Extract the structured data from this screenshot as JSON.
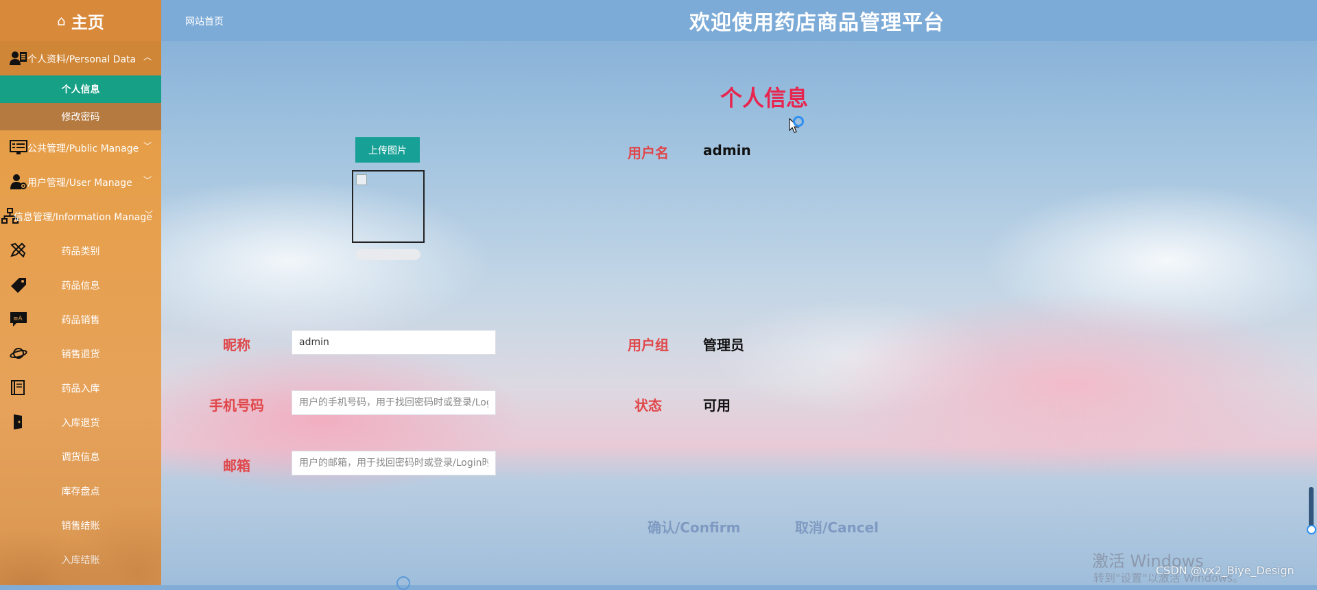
{
  "sidebar": {
    "brand": "主页",
    "groups": [
      {
        "label": "个人资料/Personal Data",
        "expanded": true,
        "icon": "user-card-icon"
      },
      {
        "label": "公共管理/Public Manage",
        "expanded": false,
        "icon": "monitor-list-icon"
      },
      {
        "label": "用户管理/User Manage",
        "expanded": false,
        "icon": "user-gear-icon"
      },
      {
        "label": "信息管理/Information Manage",
        "expanded": false,
        "icon": "sitemap-icon"
      }
    ],
    "personal_items": [
      {
        "label": "个人信息",
        "active": true
      },
      {
        "label": "修改密码",
        "active": false
      }
    ],
    "info_items": [
      {
        "label": "药品类别",
        "icon": "pencil-ruler-icon"
      },
      {
        "label": "药品信息",
        "icon": "tag-icon"
      },
      {
        "label": "药品销售",
        "icon": "chat-translate-icon"
      },
      {
        "label": "销售退货",
        "icon": "planet-icon"
      },
      {
        "label": "药品入库",
        "icon": "book-icon"
      },
      {
        "label": "入库退货",
        "icon": "door-icon"
      },
      {
        "label": "调货信息",
        "icon": ""
      },
      {
        "label": "库存盘点",
        "icon": ""
      },
      {
        "label": "销售结账",
        "icon": ""
      },
      {
        "label": "入库结账",
        "icon": ""
      }
    ]
  },
  "topbar": {
    "breadcrumb": "网站首页",
    "title": "欢迎使用药店商品管理平台"
  },
  "main": {
    "page_title": "个人信息",
    "upload_label": "上传图片",
    "fields": {
      "username_label": "用户名",
      "username_value": "admin",
      "nickname_label": "昵称",
      "nickname_value": "admin",
      "usergroup_label": "用户组",
      "usergroup_value": "管理员",
      "phone_label": "手机号码",
      "phone_placeholder": "用户的手机号码，用于找回密码时或登录/Login时",
      "status_label": "状态",
      "status_value": "可用",
      "email_label": "邮箱",
      "email_placeholder": "用户的邮箱，用于找回密码时或登录/Login时"
    },
    "confirm_label": "确认/Confirm",
    "cancel_label": "取消/Cancel"
  },
  "overlay": {
    "watermark": "激活 Windows",
    "watermark_sub": "转到\"设置\"以激活 Windows。",
    "csdn": "CSDN @vx2_Biye_Design"
  },
  "colors": {
    "sidebar": "#e39a3e",
    "active_item": "#16a085",
    "title_red": "#e8254f",
    "label_red": "#e0474a",
    "topbar": "#7cabd7"
  }
}
